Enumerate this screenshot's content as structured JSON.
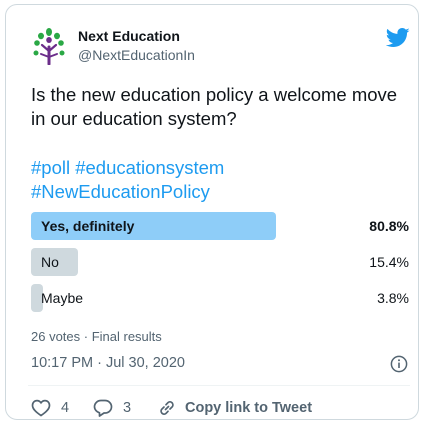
{
  "tweet": {
    "author_name": "Next Education",
    "author_handle": "@NextEducationIn",
    "question": "Is the new education policy a welcome move in our education system?",
    "hashtags": [
      "#poll #educationsystem",
      "#NewEducationPolicy"
    ]
  },
  "poll": {
    "options": [
      {
        "label": "Yes, definitely",
        "percent_text": "80.8%",
        "percent": 80.8,
        "winner": true
      },
      {
        "label": "No",
        "percent_text": "15.4%",
        "percent": 15.4,
        "winner": false
      },
      {
        "label": "Maybe",
        "percent_text": "3.8%",
        "percent": 3.8,
        "winner": false
      }
    ],
    "results_text": "26 votes · Final results"
  },
  "timestamp": "10:17 PM · Jul 30, 2020",
  "actions": {
    "likes": "4",
    "replies": "3",
    "copy_link_label": "Copy link to Tweet"
  },
  "colors": {
    "accent": "#1d9bf0",
    "winner_bar": "#8ecdf8",
    "bar": "#cfd9de",
    "logo_green": "#2aa845",
    "logo_purple": "#6b2d8a"
  },
  "icons": {
    "avatar": "next-education-tree-logo",
    "brand": "twitter-bird-icon",
    "info": "info-circle-icon",
    "like": "heart-icon",
    "reply": "reply-bubble-icon",
    "link": "link-icon"
  }
}
